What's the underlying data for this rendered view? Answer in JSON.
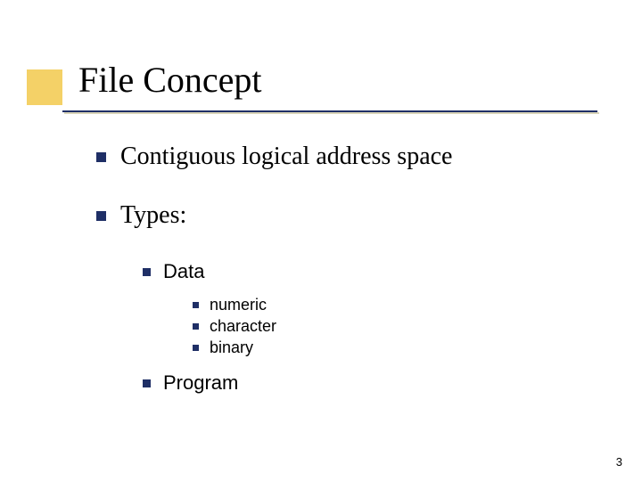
{
  "title": "File Concept",
  "bullets": {
    "b1": "Contiguous logical address space",
    "b2": "Types:",
    "b2_1": "Data",
    "b2_1_1": "numeric",
    "b2_1_2": "character",
    "b2_1_3": "binary",
    "b2_2": "Program"
  },
  "pageNumber": "3"
}
